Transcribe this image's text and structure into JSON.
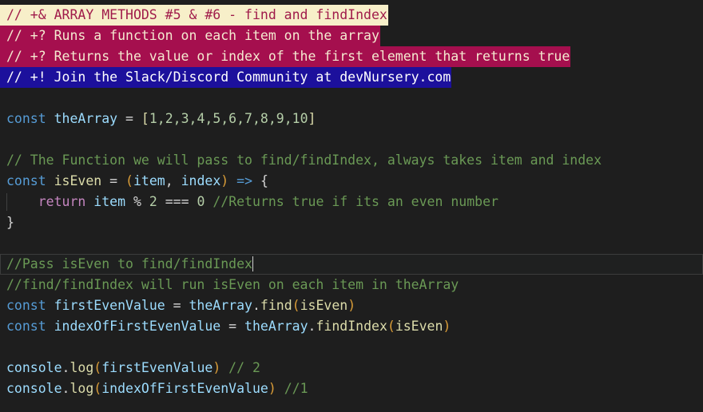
{
  "editor": {
    "theme": "dark-plus",
    "language": "javascript",
    "background": "#1e1e1e",
    "default_text_color": "#d4d4d4",
    "cursor_line_index": 12,
    "colors": {
      "banner_cream_bg": "#f7efc9",
      "banner_cream_fg": "#a01b4a",
      "banner_crimson_bg": "#a50f4e",
      "banner_crimson_fg": "#f5ead0",
      "banner_blue_bg": "#1c109c",
      "banner_blue_fg": "#ffffff",
      "keyword": "#569cd6",
      "control_keyword": "#c586c0",
      "variable": "#9cdcfe",
      "function": "#dcdcaa",
      "number": "#b5cea8",
      "punctuation": "#d4d4d4",
      "paren": "#da9d38",
      "comment": "#6a9955",
      "current_line_border": "#3c3c3c",
      "indent_guide": "#3f4040"
    }
  },
  "lines": [
    {
      "index": 0,
      "kind": "banner-cream",
      "text": "// +& ARRAY METHODS #5 & #6 - find and findIndex"
    },
    {
      "index": 1,
      "kind": "banner-crimson",
      "text": "// +? Runs a function on each item on the array"
    },
    {
      "index": 2,
      "kind": "banner-crimson",
      "text": "// +? Returns the value or index of the first element that returns true"
    },
    {
      "index": 3,
      "kind": "banner-blue",
      "text": "// +! Join the Slack/Discord Community at devNursery.com"
    },
    {
      "index": 4,
      "kind": "blank",
      "text": ""
    },
    {
      "index": 5,
      "kind": "code",
      "text": "const theArray = [1,2,3,4,5,6,7,8,9,10]"
    },
    {
      "index": 6,
      "kind": "blank",
      "text": ""
    },
    {
      "index": 7,
      "kind": "comment",
      "text": "// The Function we will pass to find/findIndex, always takes item and index"
    },
    {
      "index": 8,
      "kind": "code",
      "text": "const isEven = (item, index) => {"
    },
    {
      "index": 9,
      "kind": "code",
      "text": "    return item % 2 === 0 //Returns true if its an even number"
    },
    {
      "index": 10,
      "kind": "code",
      "text": "}"
    },
    {
      "index": 11,
      "kind": "blank",
      "text": ""
    },
    {
      "index": 12,
      "kind": "comment-current",
      "text": "//Pass isEven to find/findIndex"
    },
    {
      "index": 13,
      "kind": "comment",
      "text": "//find/findIndex will run isEven on each item in theArray"
    },
    {
      "index": 14,
      "kind": "code",
      "text": "const firstEvenValue = theArray.find(isEven)"
    },
    {
      "index": 15,
      "kind": "code",
      "text": "const indexOfFirstEvenValue = theArray.findIndex(isEven)"
    },
    {
      "index": 16,
      "kind": "blank",
      "text": ""
    },
    {
      "index": 17,
      "kind": "code",
      "text": "console.log(firstEvenValue) // 2"
    },
    {
      "index": 18,
      "kind": "code",
      "text": "console.log(indexOfFirstEvenValue) //1"
    }
  ],
  "tokens": {
    "l0_banner": "// +& ARRAY METHODS #5 & #6 - find and findIndex",
    "l1_banner": "// +? Runs a function on each item on the array",
    "l2_banner": "// +? Returns the value or index of the first element that returns true",
    "l3_banner": "// +! Join the Slack/Discord Community at devNursery.com",
    "l5_const": "const",
    "l5_sp1": " ",
    "l5_name": "theArray",
    "l5_eq": " = ",
    "l5_lbrk": "[",
    "l5_nums": "1,2,3,4,5,6,7,8,9,10",
    "l5_rbrk": "]",
    "l7_comment": "// The Function we will pass to find/findIndex, always takes item and index",
    "l8_const": "const",
    "l8_sp1": " ",
    "l8_name": "isEven",
    "l8_eq": " = ",
    "l8_lparen": "(",
    "l8_p1": "item",
    "l8_comma": ", ",
    "l8_p2": "index",
    "l8_rparen": ")",
    "l8_arrow": " => ",
    "l8_lbrace": "{",
    "l9_indent": "    ",
    "l9_return": "return",
    "l9_sp": " ",
    "l9_item": "item",
    "l9_mod": " % ",
    "l9_two": "2",
    "l9_eqeq": " === ",
    "l9_zero": "0",
    "l9_cmt": " //Returns true if its an even number",
    "l10_rbrace": "}",
    "l12_comment": "//Pass isEven to find/findIndex",
    "l13_comment": "//find/findIndex will run isEven on each item in theArray",
    "l14_const": "const",
    "l14_sp": " ",
    "l14_name": "firstEvenValue",
    "l14_eq": " = ",
    "l14_obj": "theArray",
    "l14_dot": ".",
    "l14_method": "find",
    "l14_lparen": "(",
    "l14_arg": "isEven",
    "l14_rparen": ")",
    "l15_const": "const",
    "l15_sp": " ",
    "l15_name": "indexOfFirstEvenValue",
    "l15_eq": " = ",
    "l15_obj": "theArray",
    "l15_dot": ".",
    "l15_method": "findIndex",
    "l15_lparen": "(",
    "l15_arg": "isEven",
    "l15_rparen": ")",
    "l17_obj": "console",
    "l17_dot": ".",
    "l17_method": "log",
    "l17_lparen": "(",
    "l17_arg": "firstEvenValue",
    "l17_rparen": ")",
    "l17_cmt": " // 2",
    "l18_obj": "console",
    "l18_dot": ".",
    "l18_method": "log",
    "l18_lparen": "(",
    "l18_arg": "indexOfFirstEvenValue",
    "l18_rparen": ")",
    "l18_cmt": " //1"
  }
}
